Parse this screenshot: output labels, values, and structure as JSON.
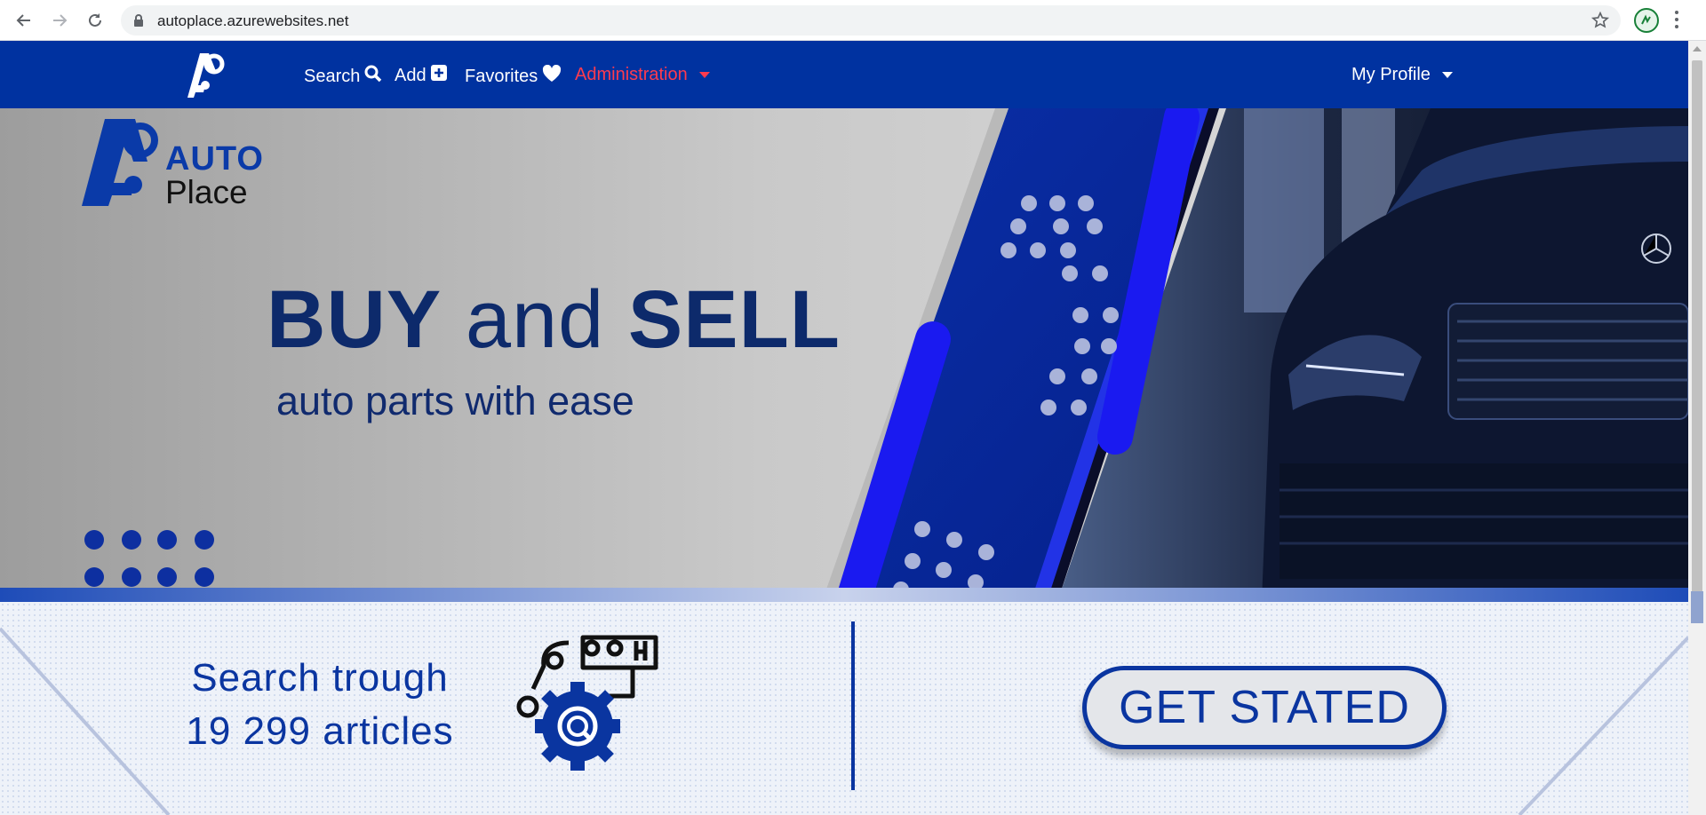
{
  "browser": {
    "url": "autoplace.azurewebsites.net",
    "icons": [
      "back-icon",
      "forward-icon",
      "reload-icon",
      "lock-icon",
      "star-icon",
      "profile-icon",
      "menu-icon"
    ]
  },
  "navbar": {
    "search_label": "Search",
    "add_label": "Add",
    "favorites_label": "Favorites",
    "administration_label": "Administration",
    "profile_label": "My Profile",
    "colors": {
      "background": "#0032a0",
      "admin": "#ff3b4e",
      "text": "#ffffff"
    }
  },
  "hero": {
    "brand_auto": "AUTO",
    "brand_place": "Place",
    "title_buy": "BUY",
    "title_and": "and",
    "title_sell": "SELL",
    "subtitle": "auto parts  with ease"
  },
  "promo": {
    "line1": "Search trough",
    "line2": "19 299 articles",
    "cta_label": "GET STATED"
  }
}
